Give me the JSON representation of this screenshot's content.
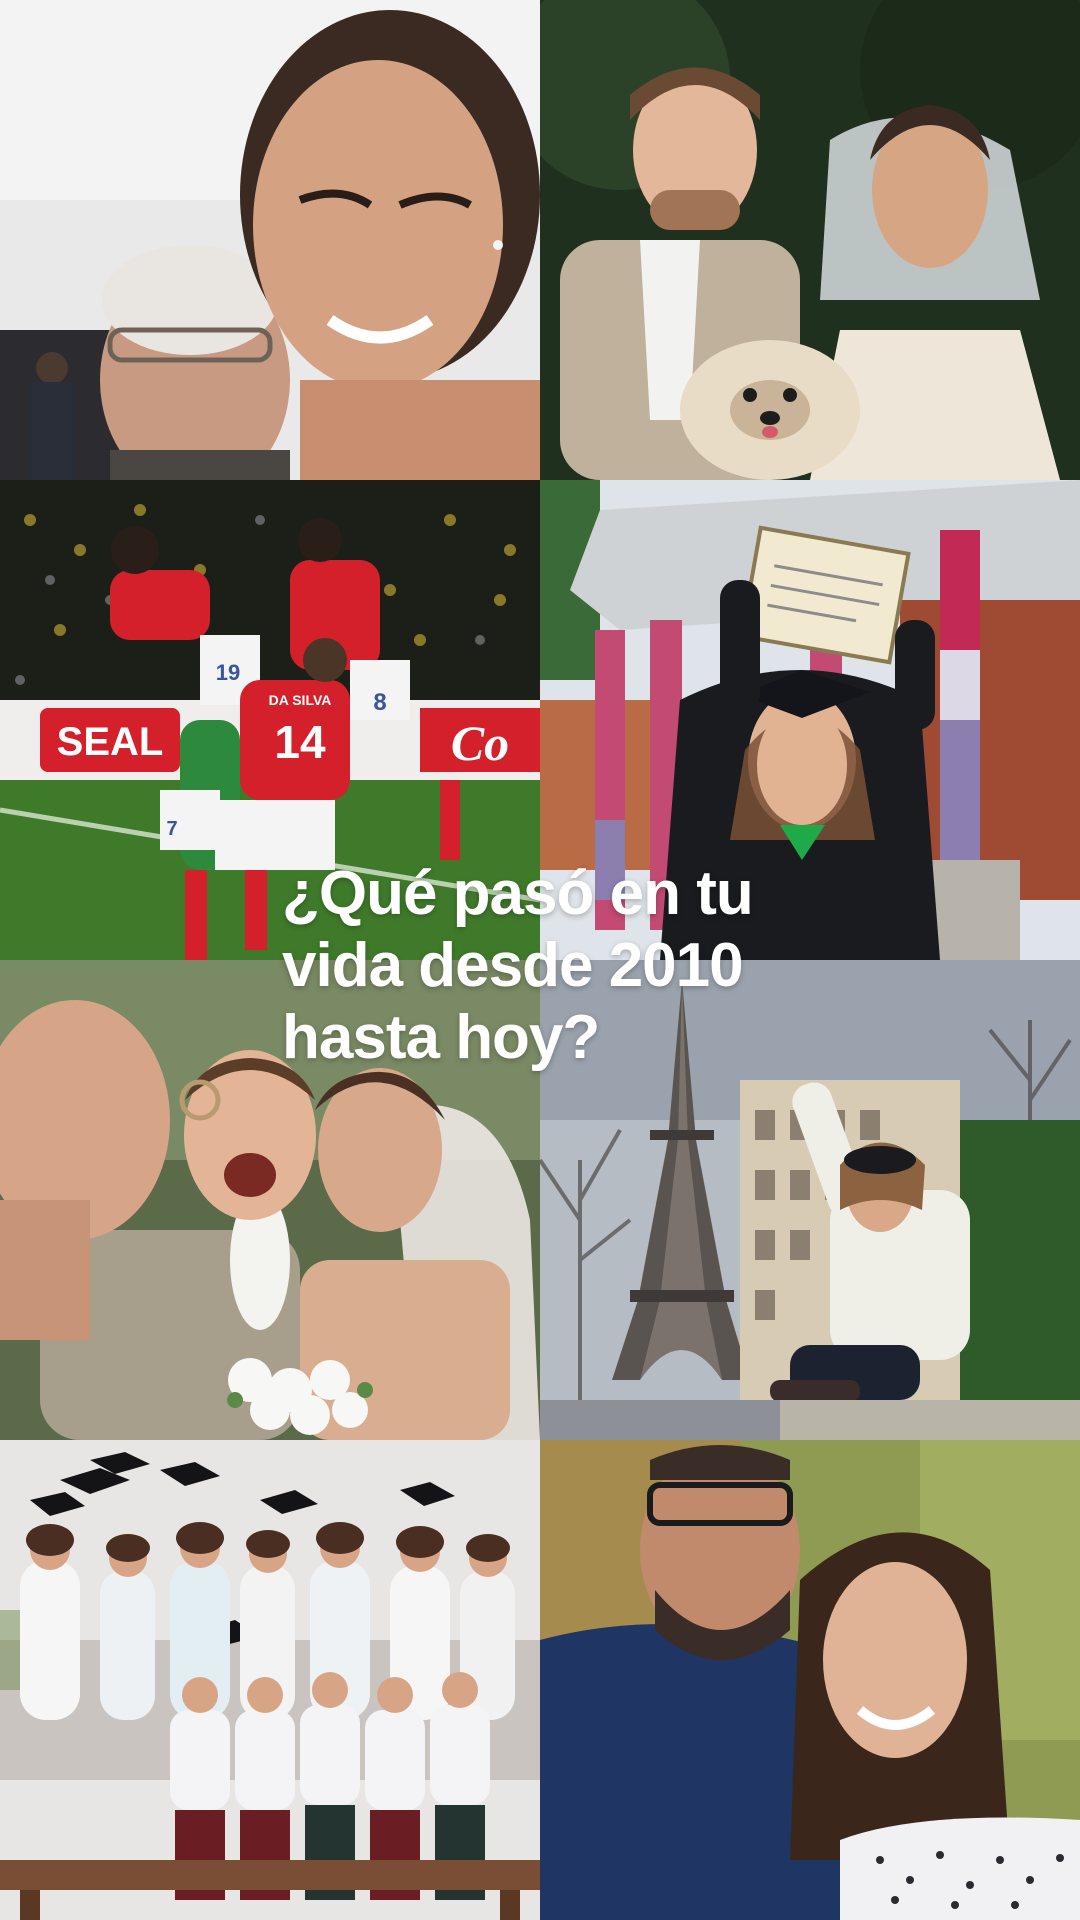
{
  "caption": "¿Qué pasó en tu\nvida desde 2010\nhasta hoy?",
  "photos": [
    {
      "name": "photo-selfie-with-grandfather"
    },
    {
      "name": "photo-couple-with-dog"
    },
    {
      "name": "photo-football-celebration"
    },
    {
      "name": "photo-graduation-diploma"
    },
    {
      "name": "photo-wedding-kiss"
    },
    {
      "name": "photo-eiffel-tower"
    },
    {
      "name": "photo-graduation-group"
    },
    {
      "name": "photo-father-daughter"
    }
  ],
  "scene_text": {
    "jersey_name": "DA SILVA",
    "jersey_number_main": "14",
    "jersey_number_left": "19",
    "jersey_number_right": "8",
    "jersey_number_small": "7",
    "ad_board_left": "SEAL",
    "ad_board_right": "Co"
  },
  "colors": {
    "caption": "#ffffff",
    "paraguay_red": "#d4202a",
    "grass": "#3f7a2a"
  }
}
